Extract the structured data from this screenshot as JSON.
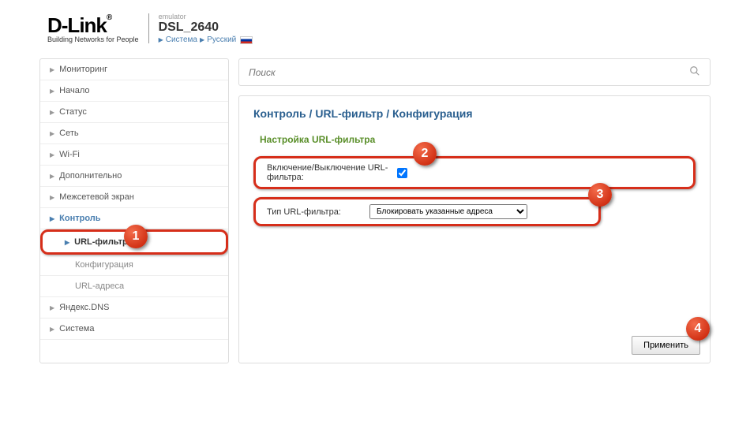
{
  "header": {
    "brand": "D-Link",
    "tagline": "Building Networks for People",
    "emulator": "emulator",
    "model": "DSL_2640",
    "link_system": "Система",
    "link_lang": "Русский"
  },
  "sidebar": {
    "items": [
      {
        "label": "Мониторинг"
      },
      {
        "label": "Начало"
      },
      {
        "label": "Статус"
      },
      {
        "label": "Сеть"
      },
      {
        "label": "Wi-Fi"
      },
      {
        "label": "Дополнительно"
      },
      {
        "label": "Межсетевой экран"
      },
      {
        "label": "Контроль",
        "expanded": true
      },
      {
        "label": "URL-фильтр",
        "sub": true,
        "active": true
      },
      {
        "label": "Конфигурация",
        "sub2": true
      },
      {
        "label": "URL-адреса",
        "sub2": true
      },
      {
        "label": "Яндекс.DNS"
      },
      {
        "label": "Система"
      }
    ]
  },
  "search": {
    "placeholder": "Поиск"
  },
  "breadcrumb": "Контроль /  URL-фильтр /  Конфигурация",
  "section_title": "Настройка URL-фильтра",
  "form": {
    "enable_label": "Включение/Выключение URL-фильтра:",
    "enable_checked": true,
    "type_label": "Тип URL-фильтра:",
    "type_value": "Блокировать указанные адреса"
  },
  "apply_label": "Применить",
  "annotations": [
    "1",
    "2",
    "3",
    "4"
  ]
}
